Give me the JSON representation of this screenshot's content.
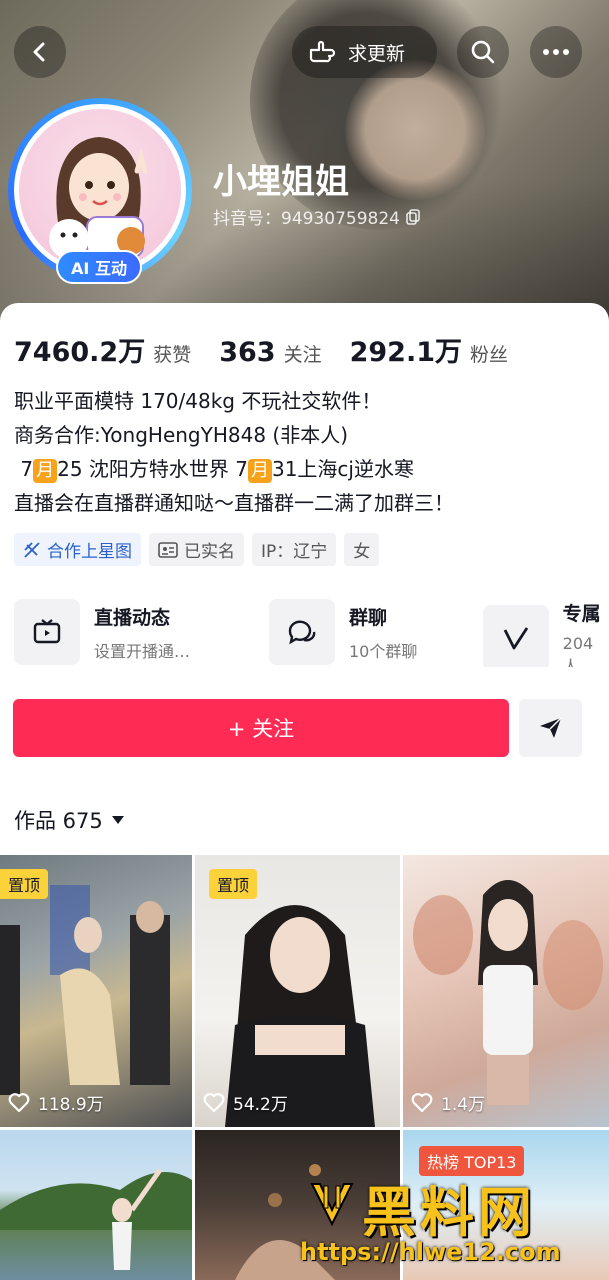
{
  "header": {
    "request_update_label": "求更新",
    "name": "小埋姐姐",
    "douyin_id": "抖音号：94930759824",
    "ai_badge": "AI 互动"
  },
  "stats": [
    {
      "value": "7460.2万",
      "label": "获赞"
    },
    {
      "value": "363",
      "label": "关注"
    },
    {
      "value": "292.1万",
      "label": "粉丝"
    }
  ],
  "bio": {
    "line1": "职业平面模特 170/48kg 不玩社交软件！",
    "line2": "商务合作:YongHengYH848 (非本人)",
    "line3_a": " 7",
    "line3_moon1": "月",
    "line3_b": "25 沈阳方特水世界 7",
    "line3_moon2": "月",
    "line3_c": "31上海cj逆水寒",
    "line4": "直播会在直播群通知哒～直播群一二满了加群三！"
  },
  "tags": [
    "合作上星图",
    "已实名",
    "IP：辽宁",
    "女"
  ],
  "services": [
    {
      "title": "直播动态",
      "sub": "设置开播通…"
    },
    {
      "title": "群聊",
      "sub": "10个群聊"
    },
    {
      "title": "专属",
      "sub": "204人"
    }
  ],
  "follow_label": "+ 关注",
  "works": {
    "label": "作品 675"
  },
  "videos": [
    {
      "badge": "置顶",
      "likes": "118.9万"
    },
    {
      "badge": "置顶",
      "likes": "54.2万"
    },
    {
      "badge": "",
      "likes": "1.4万"
    },
    {
      "badge": "",
      "likes": ""
    },
    {
      "badge": "",
      "likes": ""
    },
    {
      "badge": "热榜 TOP13",
      "likes": ""
    }
  ],
  "watermark": {
    "text": "黑料网",
    "url": "https://hlwe12.com"
  },
  "colors": {
    "accent": "#fe2c55",
    "pin": "#fcd23b",
    "ai_badge": "#2e8bff"
  }
}
